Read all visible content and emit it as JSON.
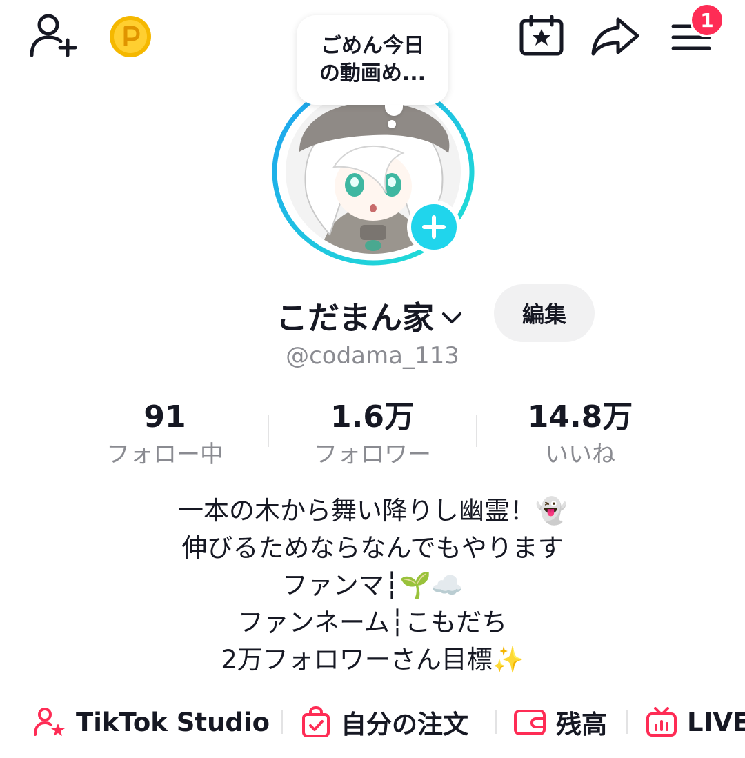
{
  "header": {
    "notification_count": "1",
    "icons": [
      "add-user-icon",
      "coin-icon",
      "calendar-star-icon",
      "share-icon",
      "menu-icon"
    ]
  },
  "status_bubble": {
    "text": "ごめん今日\nの動画め..."
  },
  "profile": {
    "display_name": "こだまん家",
    "edit_label": "編集",
    "username": "@codama_113"
  },
  "stats": [
    {
      "value": "91",
      "label": "フォロー中"
    },
    {
      "value": "1.6万",
      "label": "フォロワー"
    },
    {
      "value": "14.8万",
      "label": "いいね"
    }
  ],
  "bio": {
    "lines": [
      "一本の木から舞い降りし幽霊！👻",
      "伸びるためならなんでもやります",
      "ファンマ┆🌱☁️",
      "ファンネーム┆こもだち",
      "2万フォロワーさん目標✨"
    ]
  },
  "links": [
    {
      "label": "TikTok Studio",
      "icon": "person-star-icon"
    },
    {
      "label": "自分の注文",
      "icon": "shopping-bag-icon"
    },
    {
      "label": "残高",
      "icon": "wallet-icon"
    },
    {
      "label": "LIVE",
      "icon": "tv-icon"
    }
  ],
  "colors": {
    "accent": "#fe2c55",
    "avatar_ring": "#20d5ec",
    "muted_text": "#8a8b91"
  }
}
